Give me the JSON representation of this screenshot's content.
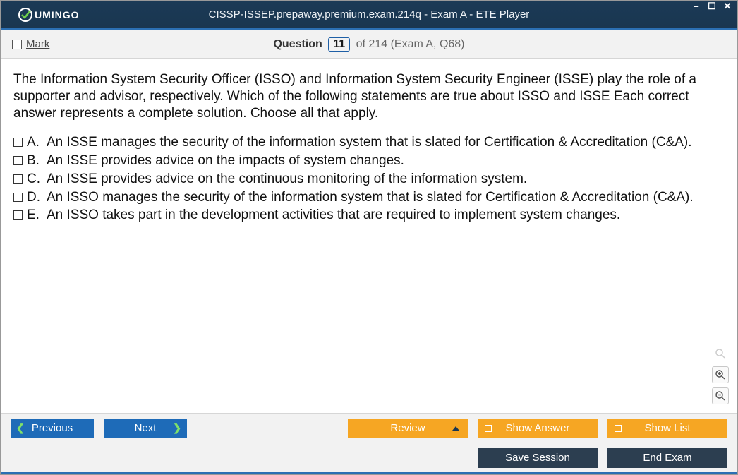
{
  "titlebar": {
    "brand": "UMINGO",
    "title": "CISSP-ISSEP.prepaway.premium.exam.214q - Exam A - ETE Player"
  },
  "header": {
    "mark_label": "Mark",
    "question_word": "Question",
    "current": "11",
    "rest": "of 214 (Exam A, Q68)"
  },
  "question": {
    "stem": "The Information System Security Officer (ISSO) and Information System Security Engineer (ISSE) play the role of a supporter and advisor, respectively. Which of the following statements are true about ISSO and ISSE Each correct answer represents a complete solution. Choose all that apply.",
    "choices": [
      {
        "letter": "A.",
        "text": "An ISSE manages the security of the information system that is slated for Certification & Accreditation (C&A)."
      },
      {
        "letter": "B.",
        "text": "An ISSE provides advice on the impacts of system changes."
      },
      {
        "letter": "C.",
        "text": "An ISSE provides advice on the continuous monitoring of the information system."
      },
      {
        "letter": "D.",
        "text": "An ISSO manages the security of the information system that is slated for Certification & Accreditation (C&A)."
      },
      {
        "letter": "E.",
        "text": "An ISSO takes part in the development activities that are required to implement system changes."
      }
    ]
  },
  "buttons": {
    "previous": "Previous",
    "next": "Next",
    "review": "Review",
    "show_answer": "Show Answer",
    "show_list": "Show List",
    "save_session": "Save Session",
    "end_exam": "End Exam"
  }
}
